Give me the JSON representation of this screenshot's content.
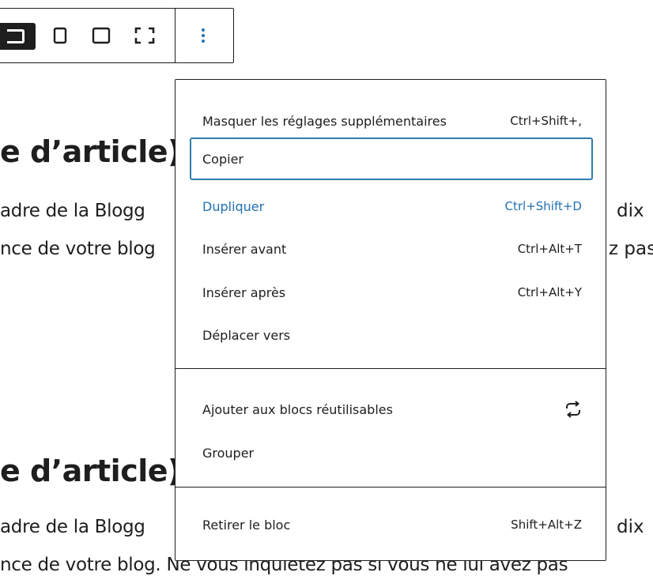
{
  "article": {
    "heading_fragment": "e d’article)",
    "para1_line1": "adre de la Blogg",
    "para1_line1_right": "dix",
    "para1_line2": "nce de votre blog",
    "para1_line2_right": "z pas",
    "heading2_fragment": "e d’article)",
    "para2_line1": "adre de la Blogg",
    "para2_line1_right": "dix",
    "para2_line2": "nce de votre blog. Ne vous inquiétez pas si vous ne lui avez pas"
  },
  "menu": {
    "group1": [
      {
        "label": "Masquer les réglages supplémentaires",
        "shortcut": "Ctrl+Shift+,"
      },
      {
        "label": "Copier",
        "shortcut": ""
      },
      {
        "label": "Dupliquer",
        "shortcut": "Ctrl+Shift+D"
      },
      {
        "label": "Insérer avant",
        "shortcut": "Ctrl+Alt+T"
      },
      {
        "label": "Insérer après",
        "shortcut": "Ctrl+Alt+Y"
      },
      {
        "label": "Déplacer vers",
        "shortcut": ""
      }
    ],
    "group2": [
      {
        "label": "Ajouter aux blocs réutilisables",
        "icon": "reusable-block-icon"
      },
      {
        "label": "Grouper"
      }
    ],
    "group3": [
      {
        "label": "Retirer le bloc",
        "shortcut": "Shift+Alt+Z"
      }
    ]
  },
  "colors": {
    "accent": "#2271b1",
    "focus_ring": "#2f7fad",
    "text": "#1e1e1e"
  }
}
